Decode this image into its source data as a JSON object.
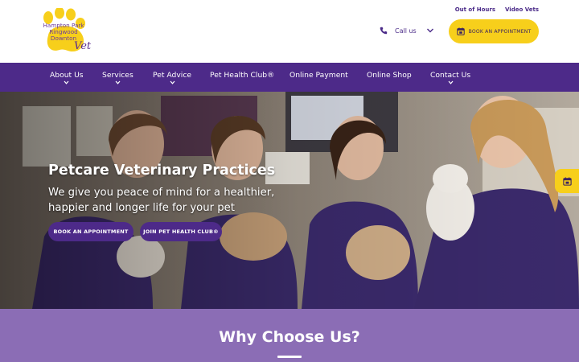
{
  "brand": {
    "logo_lines": [
      "Hampton Park",
      "Ringwood",
      "Downton"
    ],
    "logo_vet": "Vet",
    "colors": {
      "purple": "#4d2a89",
      "yellow": "#f7cf1b",
      "lavender": "#8b6db5"
    }
  },
  "header": {
    "top_links": [
      "Out of Hours",
      "Video Vets"
    ],
    "call_label": "Call us",
    "book_label": "BOOK AN APPOINTMENT"
  },
  "nav": {
    "items": [
      {
        "label": "About Us",
        "has_dropdown": true
      },
      {
        "label": "Services",
        "has_dropdown": true
      },
      {
        "label": "Pet Advice",
        "has_dropdown": true
      },
      {
        "label": "Pet Health Club®",
        "has_dropdown": false
      },
      {
        "label": "Online Payment",
        "has_dropdown": false
      },
      {
        "label": "Online Shop",
        "has_dropdown": false
      },
      {
        "label": "Contact Us",
        "has_dropdown": true
      }
    ]
  },
  "hero": {
    "title": "Petcare Veterinary Practices",
    "subtitle_line1": "We give you peace of mind for a healthier,",
    "subtitle_line2": "happier and longer life for your pet",
    "primary_button": "BOOK AN APPOINTMENT",
    "secondary_button": "JOIN PET HEALTH CLUB®"
  },
  "why": {
    "title": "Why Choose Us?"
  },
  "icons": {
    "phone": "phone-icon",
    "calendar": "calendar-icon",
    "chevron": "chevron-down-icon",
    "paw": "paw-logo-icon"
  }
}
